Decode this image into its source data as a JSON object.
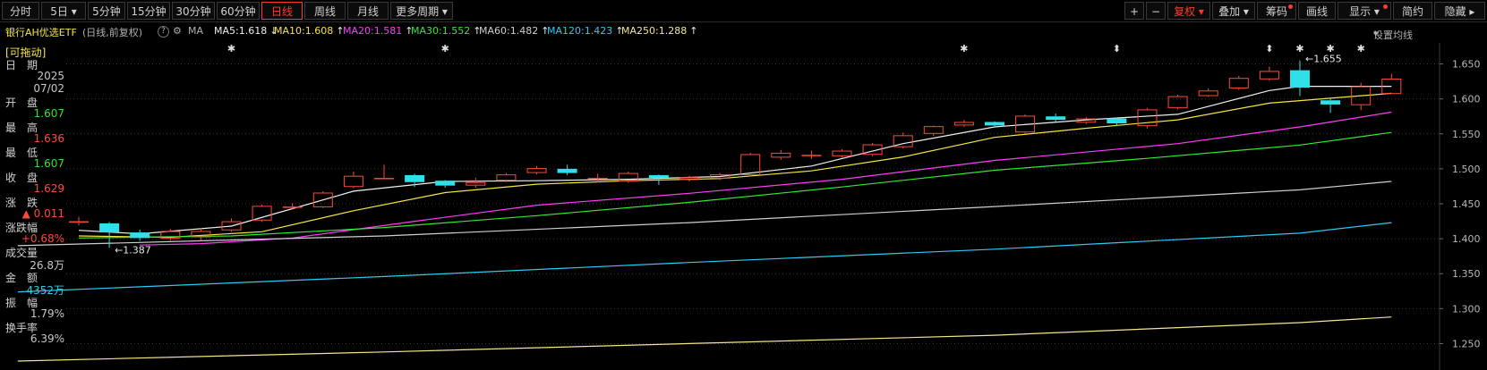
{
  "toolbar": {
    "periods": [
      "分时",
      "5日",
      "5分钟",
      "15分钟",
      "30分钟",
      "60分钟",
      "日线",
      "周线",
      "月线",
      "更多周期"
    ],
    "active_period": "日线",
    "right": {
      "plus": "+",
      "minus": "−",
      "fuquan": "复权",
      "overlay": "叠加",
      "chouma": "筹码",
      "draw": "画线",
      "display": "显示",
      "jianyue": "简约",
      "hide": "隐藏"
    }
  },
  "security": {
    "name": "银行AH优选ETF",
    "mode": "(日线,前复权)",
    "ma_label": "MA",
    "settings": "设置均线"
  },
  "ma_legend": [
    {
      "label": "MA5:1.618",
      "arrow": "↓",
      "color": "#f0f0f0"
    },
    {
      "label": "MA10:1.608",
      "arrow": "↑",
      "color": "#f5e642"
    },
    {
      "label": "MA20:1.581",
      "arrow": "↑",
      "color": "#ff3df5"
    },
    {
      "label": "MA30:1.552",
      "arrow": "↑",
      "color": "#36e836"
    },
    {
      "label": "MA60:1.482",
      "arrow": "↑",
      "color": "#cfcfcf"
    },
    {
      "label": "MA120:1.423",
      "arrow": "↑",
      "color": "#2fc9f5"
    },
    {
      "label": "MA250:1.288",
      "arrow": "↑",
      "color": "#f5e68c"
    }
  ],
  "info_panel": {
    "tag": "[可拖动]",
    "date_label": "日　期",
    "date_year": "2025",
    "date_md": "07/02",
    "open_label": "开　盘",
    "open": "1.607",
    "high_label": "最　高",
    "high": "1.636",
    "low_label": "最　低",
    "low": "1.607",
    "close_label": "收　盘",
    "close": "1.629",
    "change_label": "涨　跌",
    "change": "▲ 0.011",
    "pct_label": "涨跌幅",
    "pct": "+0.68%",
    "vol_label": "成交量",
    "vol": "26.8万",
    "amt_label": "金　额",
    "amt": "4352万",
    "amp_label": "振　幅",
    "amp": "1.79%",
    "turn_label": "换手率",
    "turn": "6.39%"
  },
  "chart_data": {
    "type": "candlestick",
    "ylim": [
      1.225,
      1.675
    ],
    "yticks": [
      1.25,
      1.3,
      1.35,
      1.4,
      1.45,
      1.5,
      1.55,
      1.6,
      1.65
    ],
    "ytick_labels": [
      "1.250",
      "1.300",
      "1.350",
      "1.400",
      "1.450",
      "1.500",
      "1.550",
      "1.600",
      "1.650"
    ],
    "candles": [
      {
        "o": 1.425,
        "c": 1.425,
        "h": 1.431,
        "l": 1.419
      },
      {
        "o": 1.422,
        "c": 1.409,
        "h": 1.424,
        "l": 1.387
      },
      {
        "o": 1.409,
        "c": 1.401,
        "h": 1.413,
        "l": 1.397
      },
      {
        "o": 1.4,
        "c": 1.411,
        "h": 1.414,
        "l": 1.397
      },
      {
        "o": 1.402,
        "c": 1.411,
        "h": 1.415,
        "l": 1.398
      },
      {
        "o": 1.412,
        "c": 1.425,
        "h": 1.429,
        "l": 1.41
      },
      {
        "o": 1.426,
        "c": 1.447,
        "h": 1.449,
        "l": 1.424
      },
      {
        "o": 1.446,
        "c": 1.446,
        "h": 1.451,
        "l": 1.442
      },
      {
        "o": 1.445,
        "c": 1.466,
        "h": 1.468,
        "l": 1.444
      },
      {
        "o": 1.474,
        "c": 1.49,
        "h": 1.496,
        "l": 1.472
      },
      {
        "o": 1.487,
        "c": 1.487,
        "h": 1.506,
        "l": 1.486
      },
      {
        "o": 1.491,
        "c": 1.481,
        "h": 1.493,
        "l": 1.474
      },
      {
        "o": 1.483,
        "c": 1.476,
        "h": 1.484,
        "l": 1.473
      },
      {
        "o": 1.476,
        "c": 1.481,
        "h": 1.487,
        "l": 1.473
      },
      {
        "o": 1.483,
        "c": 1.492,
        "h": 1.494,
        "l": 1.481
      },
      {
        "o": 1.494,
        "c": 1.501,
        "h": 1.504,
        "l": 1.492
      },
      {
        "o": 1.5,
        "c": 1.494,
        "h": 1.506,
        "l": 1.491
      },
      {
        "o": 1.487,
        "c": 1.487,
        "h": 1.493,
        "l": 1.481
      },
      {
        "o": 1.482,
        "c": 1.494,
        "h": 1.496,
        "l": 1.48
      },
      {
        "o": 1.491,
        "c": 1.487,
        "h": 1.492,
        "l": 1.477
      },
      {
        "o": 1.484,
        "c": 1.488,
        "h": 1.49,
        "l": 1.482
      },
      {
        "o": 1.486,
        "c": 1.492,
        "h": 1.494,
        "l": 1.484
      },
      {
        "o": 1.491,
        "c": 1.521,
        "h": 1.523,
        "l": 1.489
      },
      {
        "o": 1.516,
        "c": 1.523,
        "h": 1.527,
        "l": 1.513
      },
      {
        "o": 1.52,
        "c": 1.52,
        "h": 1.526,
        "l": 1.514
      },
      {
        "o": 1.518,
        "c": 1.526,
        "h": 1.528,
        "l": 1.516
      },
      {
        "o": 1.52,
        "c": 1.535,
        "h": 1.537,
        "l": 1.518
      },
      {
        "o": 1.531,
        "c": 1.548,
        "h": 1.552,
        "l": 1.529
      },
      {
        "o": 1.55,
        "c": 1.561,
        "h": 1.562,
        "l": 1.547
      },
      {
        "o": 1.562,
        "c": 1.567,
        "h": 1.57,
        "l": 1.56
      },
      {
        "o": 1.567,
        "c": 1.562,
        "h": 1.568,
        "l": 1.561
      },
      {
        "o": 1.552,
        "c": 1.576,
        "h": 1.578,
        "l": 1.55
      },
      {
        "o": 1.575,
        "c": 1.57,
        "h": 1.579,
        "l": 1.567
      },
      {
        "o": 1.566,
        "c": 1.572,
        "h": 1.574,
        "l": 1.564
      },
      {
        "o": 1.572,
        "c": 1.565,
        "h": 1.573,
        "l": 1.561
      },
      {
        "o": 1.561,
        "c": 1.585,
        "h": 1.587,
        "l": 1.558
      },
      {
        "o": 1.587,
        "c": 1.604,
        "h": 1.606,
        "l": 1.585
      },
      {
        "o": 1.604,
        "c": 1.612,
        "h": 1.615,
        "l": 1.603
      },
      {
        "o": 1.615,
        "c": 1.63,
        "h": 1.633,
        "l": 1.613
      },
      {
        "o": 1.628,
        "c": 1.64,
        "h": 1.646,
        "l": 1.626
      },
      {
        "o": 1.641,
        "c": 1.616,
        "h": 1.655,
        "l": 1.604
      },
      {
        "o": 1.598,
        "c": 1.592,
        "h": 1.6,
        "l": 1.58
      },
      {
        "o": 1.591,
        "c": 1.618,
        "h": 1.623,
        "l": 1.584
      },
      {
        "o": 1.607,
        "c": 1.629,
        "h": 1.636,
        "l": 1.607
      }
    ],
    "ma_series": [
      {
        "name": "MA5",
        "color": "#f0f0f0",
        "x": [
          0,
          2,
          5,
          9,
          12,
          15,
          18,
          21,
          24,
          27,
          30,
          33,
          36,
          39,
          40,
          43
        ],
        "y": [
          1.412,
          1.407,
          1.418,
          1.468,
          1.482,
          1.483,
          1.485,
          1.489,
          1.504,
          1.536,
          1.56,
          1.57,
          1.578,
          1.612,
          1.618,
          1.618
        ]
      },
      {
        "name": "MA10",
        "color": "#f5e642",
        "x": [
          0,
          3,
          6,
          9,
          12,
          15,
          18,
          21,
          24,
          27,
          30,
          33,
          36,
          39,
          43
        ],
        "y": [
          1.404,
          1.402,
          1.41,
          1.44,
          1.466,
          1.478,
          1.483,
          1.486,
          1.497,
          1.517,
          1.545,
          1.558,
          1.57,
          1.594,
          1.608
        ]
      },
      {
        "name": "MA20",
        "color": "#ff3df5",
        "x": [
          2,
          4,
          7,
          11,
          15,
          20,
          25,
          30,
          36,
          40,
          43
        ],
        "y": [
          1.391,
          1.393,
          1.401,
          1.425,
          1.448,
          1.465,
          1.485,
          1.512,
          1.536,
          1.56,
          1.581
        ]
      },
      {
        "name": "MA30",
        "color": "#36e836",
        "x": [
          0,
          5,
          10,
          15,
          20,
          25,
          30,
          35,
          40,
          43
        ],
        "y": [
          1.401,
          1.404,
          1.416,
          1.433,
          1.452,
          1.474,
          1.498,
          1.515,
          1.534,
          1.552
        ]
      },
      {
        "name": "MA60",
        "color": "#cfcfcf",
        "x": [
          -2,
          10,
          20,
          30,
          40,
          43
        ],
        "y": [
          1.39,
          1.404,
          1.423,
          1.446,
          1.47,
          1.482
        ]
      },
      {
        "name": "MA120",
        "color": "#2fc9f5",
        "x": [
          -2,
          10,
          20,
          30,
          40,
          43
        ],
        "y": [
          1.324,
          1.346,
          1.366,
          1.385,
          1.408,
          1.423
        ]
      },
      {
        "name": "MA250",
        "color": "#f5e68c",
        "x": [
          -2,
          10,
          20,
          30,
          40,
          43
        ],
        "y": [
          1.225,
          1.238,
          1.25,
          1.262,
          1.28,
          1.288
        ]
      }
    ],
    "annotations": [
      {
        "text": "1.387",
        "candle": 1,
        "value": 1.387,
        "side": "below"
      },
      {
        "text": "1.655",
        "candle": 40,
        "value": 1.655,
        "side": "above"
      }
    ],
    "event_markers": [
      {
        "candle": 5,
        "symbol": "✱"
      },
      {
        "candle": 12,
        "symbol": "✱"
      },
      {
        "candle": 29,
        "symbol": "✱"
      },
      {
        "candle": 34,
        "symbol": "⬍"
      },
      {
        "candle": 39,
        "symbol": "⬍"
      },
      {
        "candle": 40,
        "symbol": "✱"
      },
      {
        "candle": 41,
        "symbol": "✱"
      },
      {
        "candle": 42,
        "symbol": "✱"
      }
    ],
    "up_color": "#ff4a3a",
    "down_color": "#2fe0e8",
    "grid": "dotted"
  }
}
